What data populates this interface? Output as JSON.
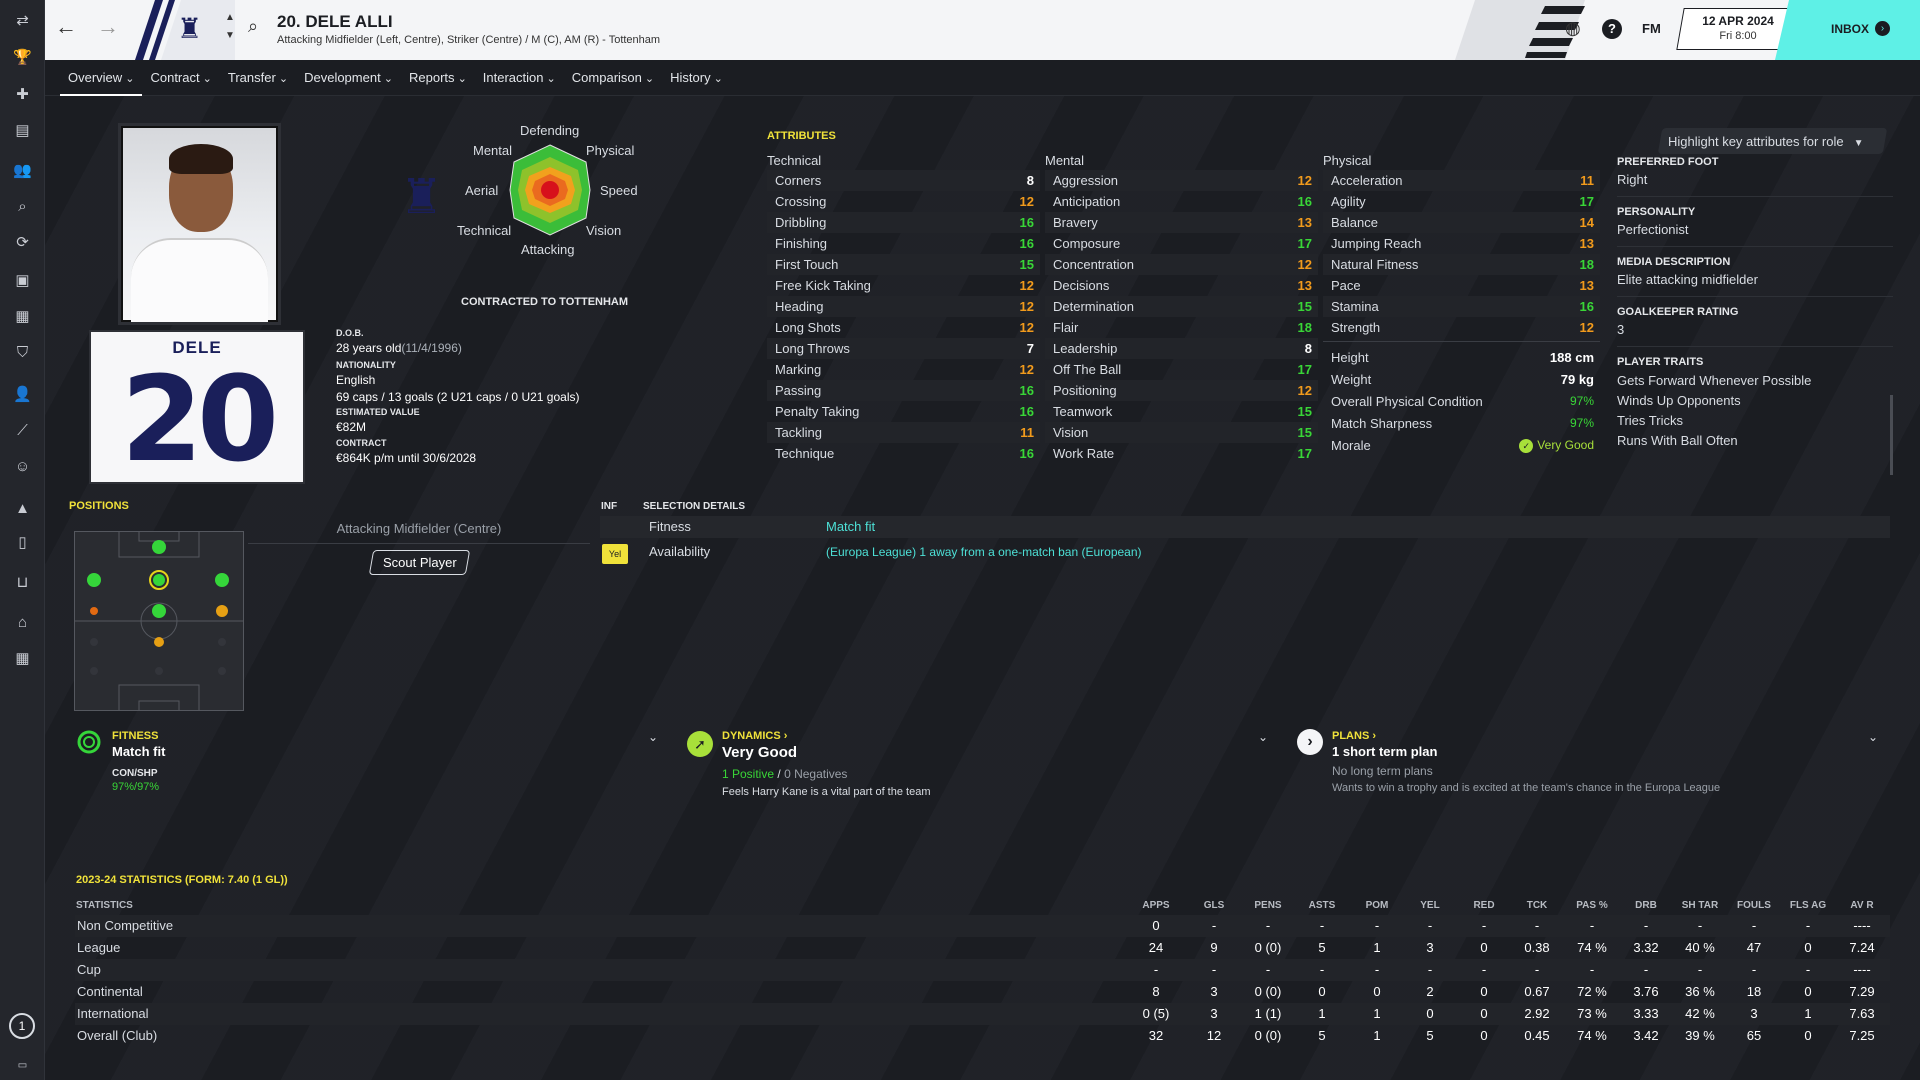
{
  "header": {
    "title": "20. DELE ALLI",
    "subtitle": "Attacking Midfielder (Left, Centre), Striker (Centre) / M (C), AM (R) - Tottenham",
    "fm": "FM",
    "date": "12 APR 2024",
    "time": "Fri 8:00",
    "inbox": "INBOX"
  },
  "tabs": [
    "Overview",
    "Contract",
    "Transfer",
    "Development",
    "Reports",
    "Interaction",
    "Comparison",
    "History"
  ],
  "player": {
    "shirt_name": "DELE",
    "number": "20",
    "contracted": "CONTRACTED TO TOTTENHAM",
    "dob_label": "D.O.B.",
    "dob_age": "28 years old",
    "dob_date": "(11/4/1996)",
    "nat_label": "NATIONALITY",
    "nat": "English",
    "caps": "69 caps / 13 goals (2 U21 caps / 0 U21 goals)",
    "value_label": "ESTIMATED VALUE",
    "value": "€82M",
    "contract_label": "CONTRACT",
    "contract": "€864K p/m until 30/6/2028"
  },
  "radar": {
    "defending": "Defending",
    "physical": "Physical",
    "speed": "Speed",
    "vision": "Vision",
    "attacking": "Attacking",
    "technical": "Technical",
    "aerial": "Aerial",
    "mental": "Mental"
  },
  "attributes": {
    "title": "ATTRIBUTES",
    "technical_title": "Technical",
    "mental_title": "Mental",
    "physical_title": "Physical",
    "technical": [
      [
        "Corners",
        "8"
      ],
      [
        "Crossing",
        "12"
      ],
      [
        "Dribbling",
        "16"
      ],
      [
        "Finishing",
        "16"
      ],
      [
        "First Touch",
        "15"
      ],
      [
        "Free Kick Taking",
        "12"
      ],
      [
        "Heading",
        "12"
      ],
      [
        "Long Shots",
        "12"
      ],
      [
        "Long Throws",
        "7"
      ],
      [
        "Marking",
        "12"
      ],
      [
        "Passing",
        "16"
      ],
      [
        "Penalty Taking",
        "16"
      ],
      [
        "Tackling",
        "11"
      ],
      [
        "Technique",
        "16"
      ]
    ],
    "mental": [
      [
        "Aggression",
        "12"
      ],
      [
        "Anticipation",
        "16"
      ],
      [
        "Bravery",
        "13"
      ],
      [
        "Composure",
        "17"
      ],
      [
        "Concentration",
        "12"
      ],
      [
        "Decisions",
        "13"
      ],
      [
        "Determination",
        "15"
      ],
      [
        "Flair",
        "18"
      ],
      [
        "Leadership",
        "8"
      ],
      [
        "Off The Ball",
        "17"
      ],
      [
        "Positioning",
        "12"
      ],
      [
        "Teamwork",
        "15"
      ],
      [
        "Vision",
        "15"
      ],
      [
        "Work Rate",
        "17"
      ]
    ],
    "physical": [
      [
        "Acceleration",
        "11"
      ],
      [
        "Agility",
        "17"
      ],
      [
        "Balance",
        "14"
      ],
      [
        "Jumping Reach",
        "13"
      ],
      [
        "Natural Fitness",
        "18"
      ],
      [
        "Pace",
        "13"
      ],
      [
        "Stamina",
        "16"
      ],
      [
        "Strength",
        "12"
      ]
    ],
    "height_label": "Height",
    "height": "188 cm",
    "weight_label": "Weight",
    "weight": "79 kg",
    "opc_label": "Overall Physical Condition",
    "opc": "97%",
    "ms_label": "Match Sharpness",
    "ms": "97%",
    "morale_label": "Morale",
    "morale": "Very Good"
  },
  "side": {
    "highlight_btn": "Highlight key attributes for role",
    "foot_label": "PREFERRED FOOT",
    "foot": "Right",
    "pers_label": "PERSONALITY",
    "pers": "Perfectionist",
    "media_label": "MEDIA DESCRIPTION",
    "media": "Elite attacking midfielder",
    "gk_label": "GOALKEEPER RATING",
    "gk": "3",
    "traits_label": "PLAYER TRAITS",
    "traits": [
      "Gets Forward Whenever Possible",
      "Winds Up Opponents",
      "Tries Tricks",
      "Runs With Ball Often"
    ]
  },
  "positions": {
    "title": "POSITIONS",
    "role": "Attacking Midfielder (Centre)",
    "scout_btn": "Scout Player"
  },
  "selection": {
    "inf": "INF",
    "title": "SELECTION DETAILS",
    "fitness_label": "Fitness",
    "fitness": "Match fit",
    "avail_label": "Availability",
    "avail_badge": "Yel",
    "avail": "(Europa League) 1 away from a one-match ban (European)"
  },
  "fitness_panel": {
    "title": "FITNESS",
    "value": "Match fit",
    "conshp_label": "CON/SHP",
    "conshp": "97%/97%"
  },
  "dynamics": {
    "title": "DYNAMICS",
    "value": "Very Good",
    "positive": "1 Positive",
    "sep": "/",
    "negatives": "0 Negatives",
    "note": "Feels Harry Kane is a vital part of the team"
  },
  "plans": {
    "title": "PLANS",
    "value": "1 short term plan",
    "long": "No long term plans",
    "note": "Wants to win a trophy and is excited at the team's chance in the Europa League"
  },
  "stats": {
    "title": "2023-24 STATISTICS (FORM: 7.40 (1 GL))",
    "label": "STATISTICS",
    "columns": [
      "APPS",
      "GLS",
      "PENS",
      "ASTS",
      "POM",
      "YEL",
      "RED",
      "TCK",
      "PAS %",
      "DRB",
      "SH TAR",
      "FOULS",
      "FLS AG",
      "AV R"
    ],
    "rows": [
      [
        "Non Competitive",
        "0",
        "-",
        "-",
        "-",
        "-",
        "-",
        "-",
        "-",
        "-",
        "-",
        "-",
        "-",
        "-",
        "----"
      ],
      [
        "League",
        "24",
        "9",
        "0 (0)",
        "5",
        "1",
        "3",
        "0",
        "0.38",
        "74 %",
        "3.32",
        "40 %",
        "47",
        "0",
        "7.24"
      ],
      [
        "Cup",
        "-",
        "-",
        "-",
        "-",
        "-",
        "-",
        "-",
        "-",
        "-",
        "-",
        "-",
        "-",
        "-",
        "----"
      ],
      [
        "Continental",
        "8",
        "3",
        "0 (0)",
        "0",
        "0",
        "2",
        "0",
        "0.67",
        "72 %",
        "3.76",
        "36 %",
        "18",
        "0",
        "7.29"
      ],
      [
        "International",
        "0 (5)",
        "3",
        "1 (1)",
        "1",
        "1",
        "0",
        "0",
        "2.92",
        "73 %",
        "3.33",
        "42 %",
        "3",
        "1",
        "7.63"
      ],
      [
        "Overall (Club)",
        "32",
        "12",
        "0 (0)",
        "5",
        "1",
        "5",
        "0",
        "0.45",
        "74 %",
        "3.42",
        "39 %",
        "65",
        "0",
        "7.25"
      ]
    ]
  },
  "nav": {
    "badge": "1"
  },
  "colors": {
    "accent": "#f0e23a",
    "green": "#39d637",
    "orange": "#f29b1c",
    "inbox": "#5ef0e6"
  }
}
